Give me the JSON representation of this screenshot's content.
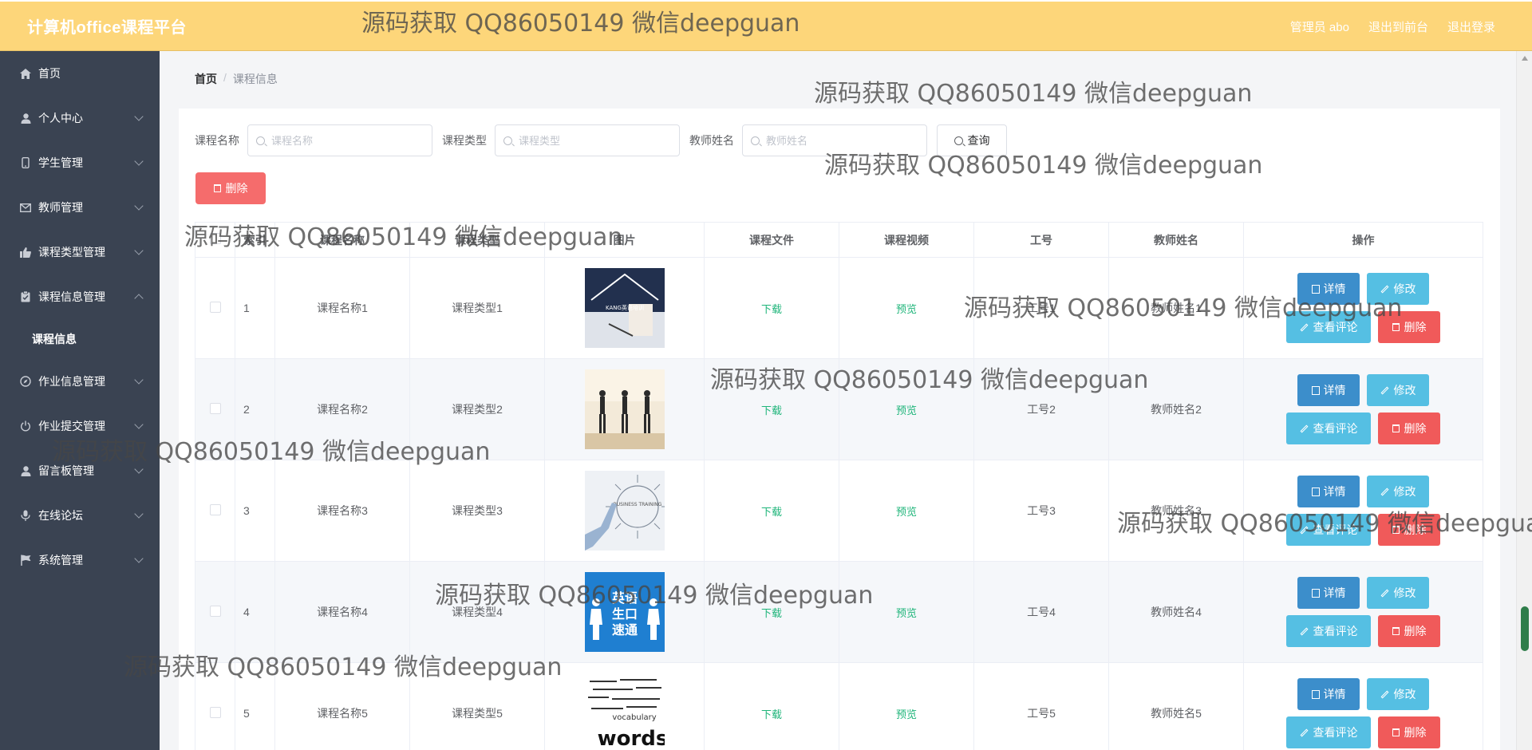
{
  "app": {
    "title": "计算机office课程平台"
  },
  "topbar": {
    "user_label": "管理员 abo",
    "frontend_link": "退出到前台",
    "logout_link": "退出登录"
  },
  "sidebar": {
    "items": [
      {
        "label": "首页",
        "icon": "home-icon",
        "expandable": false
      },
      {
        "label": "个人中心",
        "icon": "user-icon",
        "expandable": true
      },
      {
        "label": "学生管理",
        "icon": "phone-icon",
        "expandable": true
      },
      {
        "label": "教师管理",
        "icon": "mail-icon",
        "expandable": true
      },
      {
        "label": "课程类型管理",
        "icon": "thumbs-up-icon",
        "expandable": true
      },
      {
        "label": "课程信息管理",
        "icon": "clipboard-icon",
        "expandable": true,
        "expanded": true,
        "children": [
          {
            "label": "课程信息"
          }
        ]
      },
      {
        "label": "作业信息管理",
        "icon": "compass-icon",
        "expandable": true
      },
      {
        "label": "作业提交管理",
        "icon": "power-icon",
        "expandable": true
      },
      {
        "label": "留言板管理",
        "icon": "user-icon",
        "expandable": true
      },
      {
        "label": "在线论坛",
        "icon": "microphone-icon",
        "expandable": true
      },
      {
        "label": "系统管理",
        "icon": "flag-icon",
        "expandable": true
      }
    ]
  },
  "breadcrumb": {
    "home": "首页",
    "separator": "/",
    "current": "课程信息"
  },
  "search": {
    "fields": [
      {
        "label": "课程名称",
        "placeholder": "课程名称",
        "value": ""
      },
      {
        "label": "课程类型",
        "placeholder": "课程类型",
        "value": ""
      },
      {
        "label": "教师姓名",
        "placeholder": "教师姓名",
        "value": ""
      }
    ],
    "query_label": "查询"
  },
  "toolbar": {
    "delete_label": "删除"
  },
  "table": {
    "columns": [
      "",
      "索引",
      "课程名称",
      "课程类型",
      "图片",
      "课程文件",
      "课程视频",
      "工号",
      "教师姓名",
      "操作"
    ],
    "rows": [
      {
        "index": "1",
        "name": "课程名称1",
        "type": "课程类型1",
        "image": "image-1",
        "file": "下载",
        "video": "预览",
        "job_no": "工号1",
        "teacher": "教师姓名1"
      },
      {
        "index": "2",
        "name": "课程名称2",
        "type": "课程类型2",
        "image": "image-2",
        "file": "下载",
        "video": "预览",
        "job_no": "工号2",
        "teacher": "教师姓名2"
      },
      {
        "index": "3",
        "name": "课程名称3",
        "type": "课程类型3",
        "image": "image-3",
        "file": "下载",
        "video": "预览",
        "job_no": "工号3",
        "teacher": "教师姓名3"
      },
      {
        "index": "4",
        "name": "课程名称4",
        "type": "课程类型4",
        "image": "image-4",
        "file": "下载",
        "video": "预览",
        "job_no": "工号4",
        "teacher": "教师姓名4"
      },
      {
        "index": "5",
        "name": "课程名称5",
        "type": "课程类型5",
        "image": "image-5",
        "file": "下载",
        "video": "预览",
        "job_no": "工号5",
        "teacher": "教师姓名5"
      }
    ],
    "actions": {
      "detail": "详情",
      "edit": "修改",
      "comment": "查看评论",
      "delete": "删除"
    }
  },
  "watermark": {
    "text": "源码获取 QQ86050149 微信deepguan"
  },
  "image_texts": {
    "img4_line1": "英语",
    "img4_line2": "生口",
    "img4_line3": "速通",
    "img5_word": "words",
    "img5_sub": "vocabulary",
    "img3_text": "BUSINESS TRAINING",
    "img1_text": "KANG英语培训"
  },
  "colors": {
    "topbar": "#fdd67a",
    "sidebar": "#3a4352",
    "danger": "#f56c6c",
    "primary": "#3c8ecb",
    "info": "#55bfe3",
    "link": "#1fb57a"
  }
}
